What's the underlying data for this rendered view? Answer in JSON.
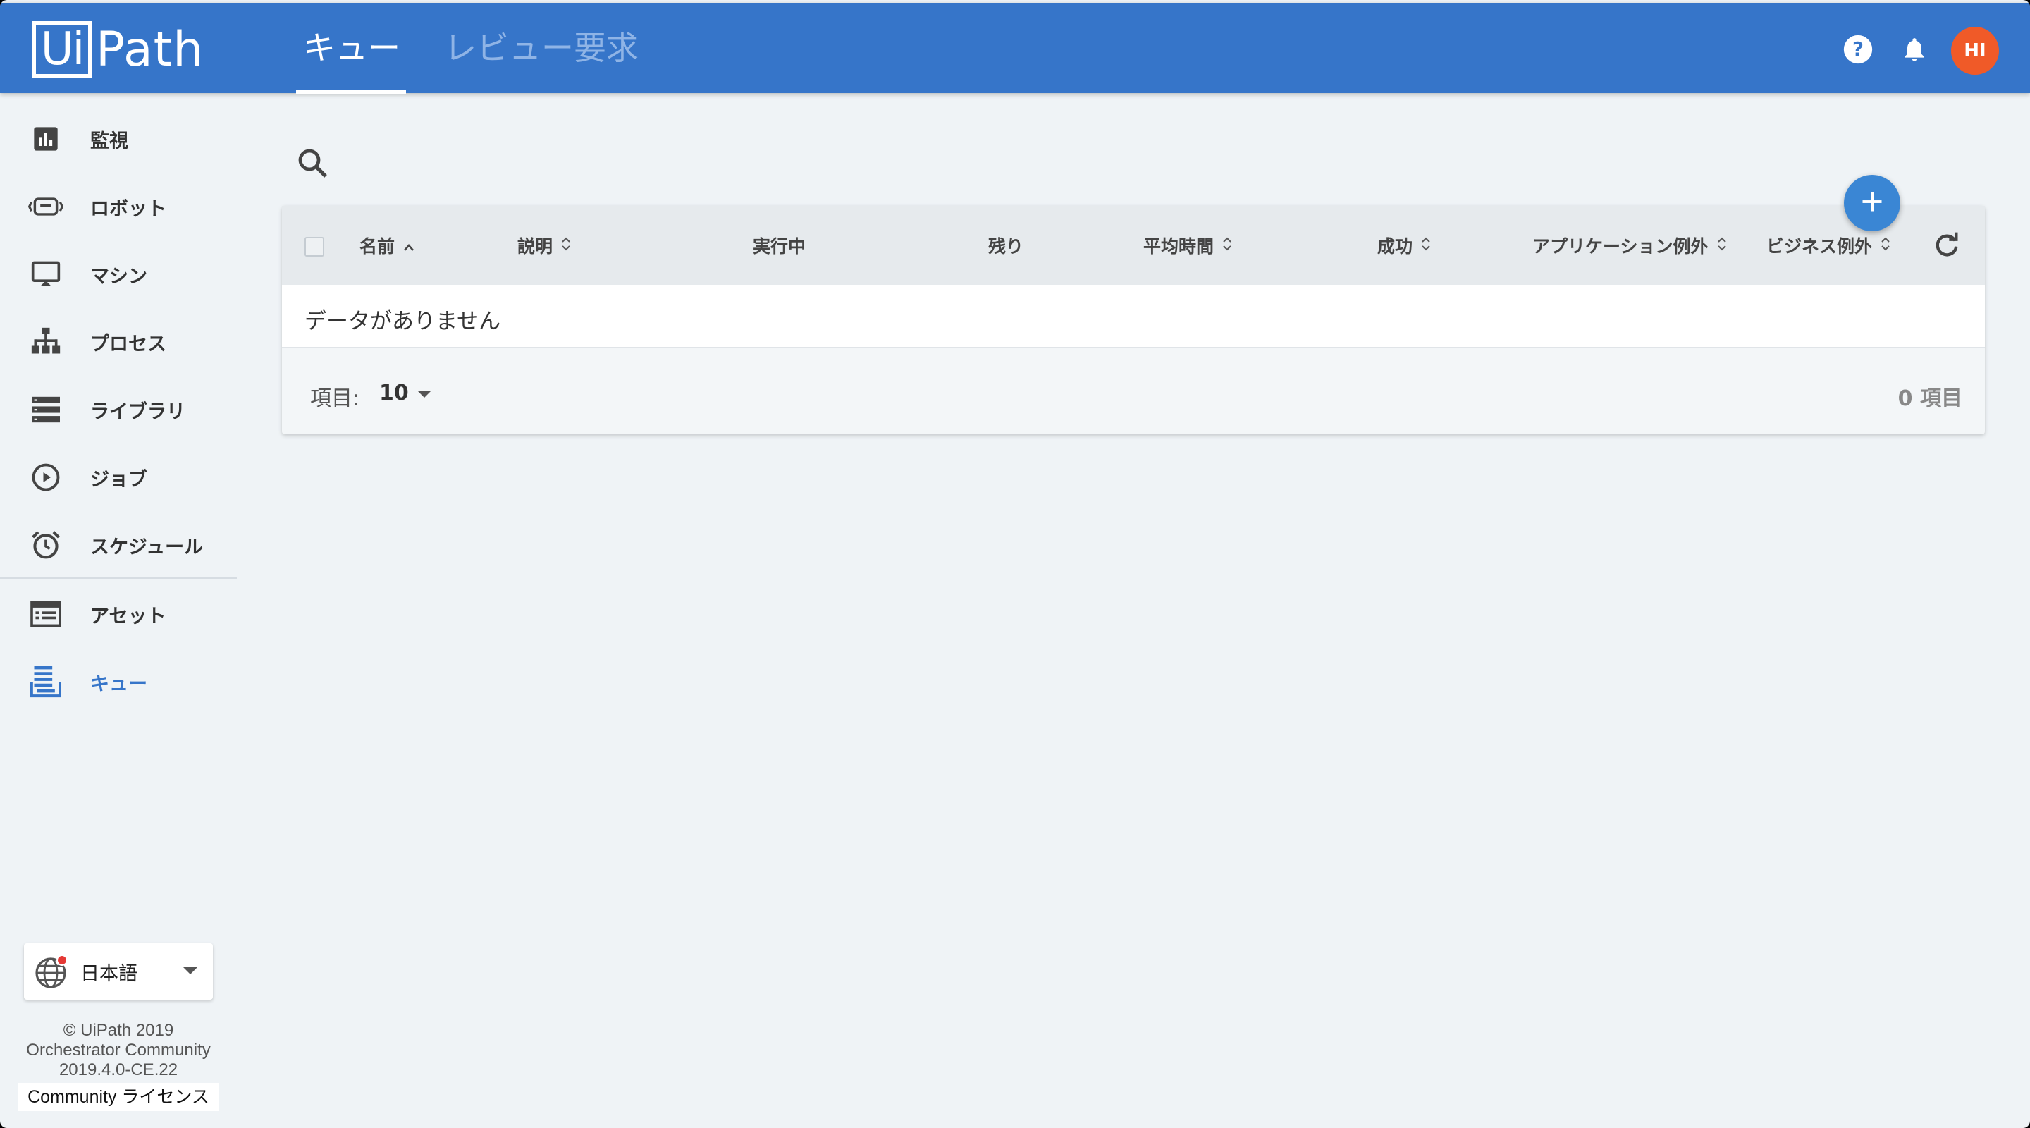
{
  "header": {
    "logo_box": "Ui",
    "logo_rest": "Path",
    "tabs": [
      {
        "label": "キュー",
        "active": true
      },
      {
        "label": "レビュー要求",
        "active": false
      }
    ],
    "avatar_initials": "HI",
    "icons": [
      "help-icon",
      "bell-icon"
    ],
    "colors": {
      "header_bg": "#3675c9",
      "avatar_bg": "#f05a28",
      "accent": "#3675c9"
    }
  },
  "sidebar": {
    "items": [
      {
        "label": "監視",
        "icon": "chart-icon"
      },
      {
        "label": "ロボット",
        "icon": "robot-icon"
      },
      {
        "label": "マシン",
        "icon": "monitor-icon"
      },
      {
        "label": "プロセス",
        "icon": "hierarchy-icon"
      },
      {
        "label": "ライブラリ",
        "icon": "library-icon"
      },
      {
        "label": "ジョブ",
        "icon": "play-icon"
      },
      {
        "label": "スケジュール",
        "icon": "alarm-icon"
      },
      {
        "label": "アセット",
        "icon": "asset-icon"
      },
      {
        "label": "キュー",
        "icon": "queue-icon",
        "active": true
      }
    ],
    "language": "日本語",
    "footer": {
      "copyright": "© UiPath 2019",
      "product": "Orchestrator Community",
      "version": "2019.4.0-CE.22",
      "license": "Community ライセンス"
    }
  },
  "table": {
    "columns": [
      {
        "label": "名前",
        "sort": "asc"
      },
      {
        "label": "説明",
        "sort": "both"
      },
      {
        "label": "実行中",
        "sort": "none"
      },
      {
        "label": "残り",
        "sort": "none"
      },
      {
        "label": "平均時間",
        "sort": "both"
      },
      {
        "label": "成功",
        "sort": "both"
      },
      {
        "label": "アプリケーション例外",
        "sort": "both"
      },
      {
        "label": "ビジネス例外",
        "sort": "both"
      }
    ],
    "empty_message": "データがありません",
    "pager": {
      "label": "項目:",
      "page_size": "10",
      "count": "0 項目"
    }
  }
}
